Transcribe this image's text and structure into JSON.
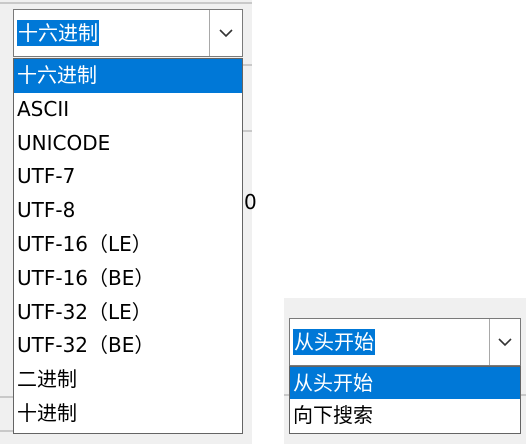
{
  "encoding_combo": {
    "selected_value": "十六进制",
    "button_icon": "chevron-down-icon",
    "options": [
      "十六进制",
      "ASCII",
      "UNICODE",
      "UTF-7",
      "UTF-8",
      "UTF-16（LE）",
      "UTF-16（BE）",
      "UTF-32（LE）",
      "UTF-32（BE）",
      "二进制",
      "十进制"
    ],
    "highlighted_index": 0
  },
  "background_fragment": "0",
  "search_combo": {
    "selected_value": "从头开始",
    "button_icon": "chevron-down-icon",
    "options": [
      "从头开始",
      "向下搜索"
    ],
    "highlighted_index": 0
  },
  "colors": {
    "selection": "#0078d7",
    "selection_text": "#ffffff",
    "panel_bg": "#f0f0f0"
  }
}
